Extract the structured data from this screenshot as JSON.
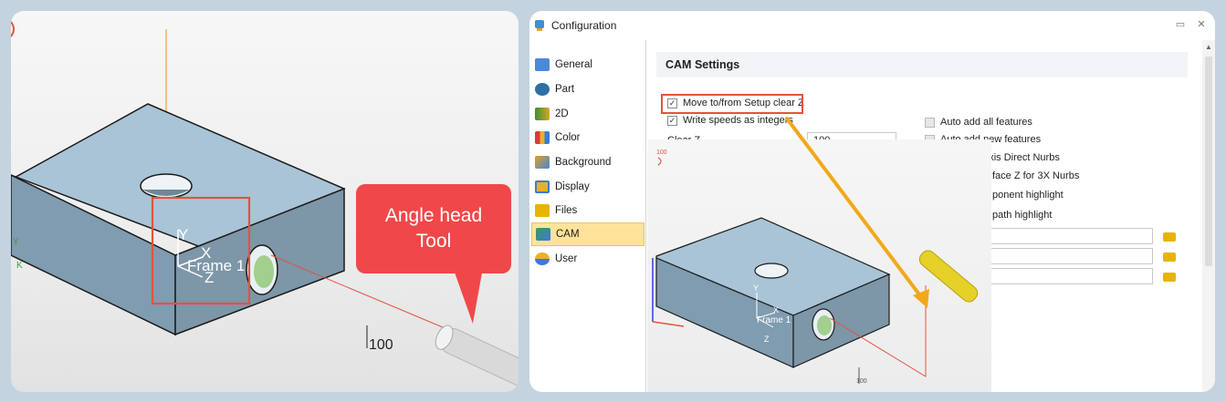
{
  "left_panel": {
    "frame_label": "Frame 1",
    "axis_y": "Y",
    "axis_x": "X",
    "axis_z": "Z",
    "callout_line1": "Angle head",
    "callout_line2": "Tool",
    "dimension": "100",
    "colors": {
      "accent_red": "#e25340",
      "callout": "#f04848",
      "block": "#8aa9bd"
    }
  },
  "window": {
    "title": "Configuration",
    "icons": [
      "app-icon",
      "restore-icon",
      "close-icon"
    ]
  },
  "sidebar": {
    "items": [
      {
        "label": "General",
        "icon": "general-icon"
      },
      {
        "label": "Part",
        "icon": "part-icon"
      },
      {
        "label": "2D",
        "icon": "2d-icon"
      },
      {
        "label": "Color",
        "icon": "color-icon"
      },
      {
        "label": "Background",
        "icon": "background-icon"
      },
      {
        "label": "Display",
        "icon": "display-icon"
      },
      {
        "label": "Files",
        "icon": "folder-icon"
      },
      {
        "label": "CAM",
        "icon": "cam-icon",
        "active": true
      },
      {
        "label": "User",
        "icon": "user-icon"
      }
    ]
  },
  "cam_settings": {
    "header": "CAM Settings",
    "move_clear_z": {
      "label": "Move to/from Setup clear Z",
      "checked": true
    },
    "write_speeds": {
      "label": "Write speeds as integers",
      "checked": true
    },
    "clear_z_label": "Clear Z",
    "clear_z_value": "100",
    "auto_add_all": {
      "label": "Auto add all features",
      "checked": false
    },
    "auto_add_new": {
      "label": "Auto add new features",
      "checked": false
    },
    "enable_3axis": {
      "label": "Enable 3 Axis Direct Nurbs",
      "checked": false
    },
    "partial_1": "face Z for 3X Nurbs",
    "partial_2": "ponent highlight",
    "partial_3": "path highlight"
  },
  "viewport": {
    "dimension_red": "100",
    "dimension_bottom": "100",
    "frame_label": "Frame 1",
    "axis_y": "Y",
    "axis_x": "X",
    "axis_z": "Z"
  }
}
